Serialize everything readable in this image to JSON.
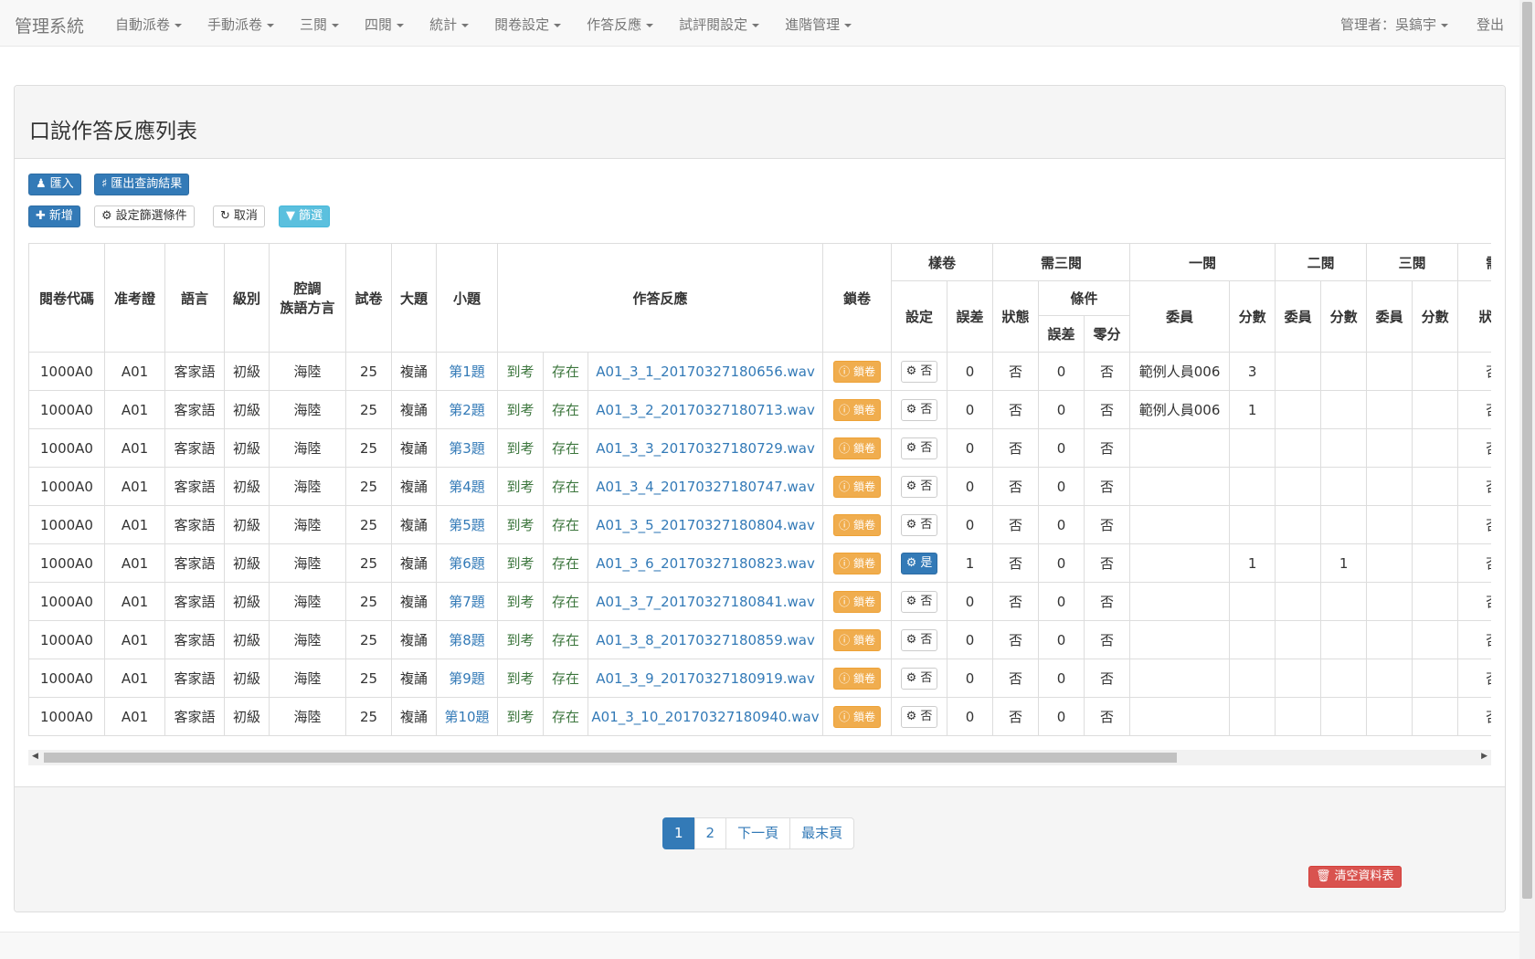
{
  "navbar": {
    "brand": "管理系統",
    "menu": [
      "自動派卷",
      "手動派卷",
      "三閱",
      "四閱",
      "統計",
      "閱卷設定",
      "作答反應",
      "試評閱設定",
      "進階管理"
    ],
    "user": "管理者：吳鎬宇",
    "logout": "登出"
  },
  "panel": {
    "title": "口說作答反應列表",
    "buttons": {
      "import": "匯入",
      "export": "匯出查詢結果",
      "add": "新增",
      "set_filter": "設定篩選條件",
      "cancel": "取消",
      "filter": "篩選"
    },
    "clear_table": "清空資料表"
  },
  "table": {
    "headers": {
      "code": "閱卷代碼",
      "ticket": "准考證",
      "language": "語言",
      "level": "級別",
      "dialect_l1": "腔調",
      "dialect_l2": "族語方言",
      "paper": "試卷",
      "section": "大題",
      "question": "小題",
      "response": "作答反應",
      "lock": "鎖卷",
      "sample": "樣卷",
      "need3": "需三閱",
      "first": "一閱",
      "second": "二閱",
      "third": "三閱",
      "fourth_partial": "需",
      "setting": "設定",
      "error": "誤差",
      "status": "狀態",
      "condition": "條件",
      "cond_error": "誤差",
      "cond_zero": "零分",
      "committee": "委員",
      "score": "分數"
    },
    "lock_label": "鎖卷",
    "rows": [
      {
        "code": "1000A0",
        "ticket": "A01",
        "lang": "客家語",
        "level": "初級",
        "dialect": "海陸",
        "paper": "25",
        "section": "複誦",
        "q": "第1題",
        "attend": "到考",
        "exist": "存在",
        "file": "A01_3_1_20170327180656.wav",
        "sample": "否",
        "err": "0",
        "status": "否",
        "c_err": "0",
        "c_zero": "否",
        "r1_member": "範例人員006",
        "r1_score": "3",
        "r2_member": "",
        "r2_score": "",
        "r3_member": "",
        "r3_score": "",
        "last": "否"
      },
      {
        "code": "1000A0",
        "ticket": "A01",
        "lang": "客家語",
        "level": "初級",
        "dialect": "海陸",
        "paper": "25",
        "section": "複誦",
        "q": "第2題",
        "attend": "到考",
        "exist": "存在",
        "file": "A01_3_2_20170327180713.wav",
        "sample": "否",
        "err": "0",
        "status": "否",
        "c_err": "0",
        "c_zero": "否",
        "r1_member": "範例人員006",
        "r1_score": "1",
        "r2_member": "",
        "r2_score": "",
        "r3_member": "",
        "r3_score": "",
        "last": "否"
      },
      {
        "code": "1000A0",
        "ticket": "A01",
        "lang": "客家語",
        "level": "初級",
        "dialect": "海陸",
        "paper": "25",
        "section": "複誦",
        "q": "第3題",
        "attend": "到考",
        "exist": "存在",
        "file": "A01_3_3_20170327180729.wav",
        "sample": "否",
        "err": "0",
        "status": "否",
        "c_err": "0",
        "c_zero": "否",
        "r1_member": "",
        "r1_score": "",
        "r2_member": "",
        "r2_score": "",
        "r3_member": "",
        "r3_score": "",
        "last": "否"
      },
      {
        "code": "1000A0",
        "ticket": "A01",
        "lang": "客家語",
        "level": "初級",
        "dialect": "海陸",
        "paper": "25",
        "section": "複誦",
        "q": "第4題",
        "attend": "到考",
        "exist": "存在",
        "file": "A01_3_4_20170327180747.wav",
        "sample": "否",
        "err": "0",
        "status": "否",
        "c_err": "0",
        "c_zero": "否",
        "r1_member": "",
        "r1_score": "",
        "r2_member": "",
        "r2_score": "",
        "r3_member": "",
        "r3_score": "",
        "last": "否"
      },
      {
        "code": "1000A0",
        "ticket": "A01",
        "lang": "客家語",
        "level": "初級",
        "dialect": "海陸",
        "paper": "25",
        "section": "複誦",
        "q": "第5題",
        "attend": "到考",
        "exist": "存在",
        "file": "A01_3_5_20170327180804.wav",
        "sample": "否",
        "err": "0",
        "status": "否",
        "c_err": "0",
        "c_zero": "否",
        "r1_member": "",
        "r1_score": "",
        "r2_member": "",
        "r2_score": "",
        "r3_member": "",
        "r3_score": "",
        "last": "否"
      },
      {
        "code": "1000A0",
        "ticket": "A01",
        "lang": "客家語",
        "level": "初級",
        "dialect": "海陸",
        "paper": "25",
        "section": "複誦",
        "q": "第6題",
        "attend": "到考",
        "exist": "存在",
        "file": "A01_3_6_20170327180823.wav",
        "sample": "是",
        "err": "1",
        "status": "否",
        "c_err": "0",
        "c_zero": "否",
        "r1_member": "",
        "r1_score": "1",
        "r2_member": "",
        "r2_score": "1",
        "r3_member": "",
        "r3_score": "",
        "last": "否"
      },
      {
        "code": "1000A0",
        "ticket": "A01",
        "lang": "客家語",
        "level": "初級",
        "dialect": "海陸",
        "paper": "25",
        "section": "複誦",
        "q": "第7題",
        "attend": "到考",
        "exist": "存在",
        "file": "A01_3_7_20170327180841.wav",
        "sample": "否",
        "err": "0",
        "status": "否",
        "c_err": "0",
        "c_zero": "否",
        "r1_member": "",
        "r1_score": "",
        "r2_member": "",
        "r2_score": "",
        "r3_member": "",
        "r3_score": "",
        "last": "否"
      },
      {
        "code": "1000A0",
        "ticket": "A01",
        "lang": "客家語",
        "level": "初級",
        "dialect": "海陸",
        "paper": "25",
        "section": "複誦",
        "q": "第8題",
        "attend": "到考",
        "exist": "存在",
        "file": "A01_3_8_20170327180859.wav",
        "sample": "否",
        "err": "0",
        "status": "否",
        "c_err": "0",
        "c_zero": "否",
        "r1_member": "",
        "r1_score": "",
        "r2_member": "",
        "r2_score": "",
        "r3_member": "",
        "r3_score": "",
        "last": "否"
      },
      {
        "code": "1000A0",
        "ticket": "A01",
        "lang": "客家語",
        "level": "初級",
        "dialect": "海陸",
        "paper": "25",
        "section": "複誦",
        "q": "第9題",
        "attend": "到考",
        "exist": "存在",
        "file": "A01_3_9_20170327180919.wav",
        "sample": "否",
        "err": "0",
        "status": "否",
        "c_err": "0",
        "c_zero": "否",
        "r1_member": "",
        "r1_score": "",
        "r2_member": "",
        "r2_score": "",
        "r3_member": "",
        "r3_score": "",
        "last": "否"
      },
      {
        "code": "1000A0",
        "ticket": "A01",
        "lang": "客家語",
        "level": "初級",
        "dialect": "海陸",
        "paper": "25",
        "section": "複誦",
        "q": "第10題",
        "attend": "到考",
        "exist": "存在",
        "file": "A01_3_10_20170327180940.wav",
        "sample": "否",
        "err": "0",
        "status": "否",
        "c_err": "0",
        "c_zero": "否",
        "r1_member": "",
        "r1_score": "",
        "r2_member": "",
        "r2_score": "",
        "r3_member": "",
        "r3_score": "",
        "last": "否"
      }
    ]
  },
  "pagination": {
    "pages": [
      "1",
      "2"
    ],
    "next": "下一頁",
    "last": "最末頁"
  },
  "colors": {
    "primary": "#337ab7",
    "warning": "#f0ad4e",
    "info": "#5bc0de",
    "danger": "#d9534f",
    "success_text": "#3c763d"
  }
}
